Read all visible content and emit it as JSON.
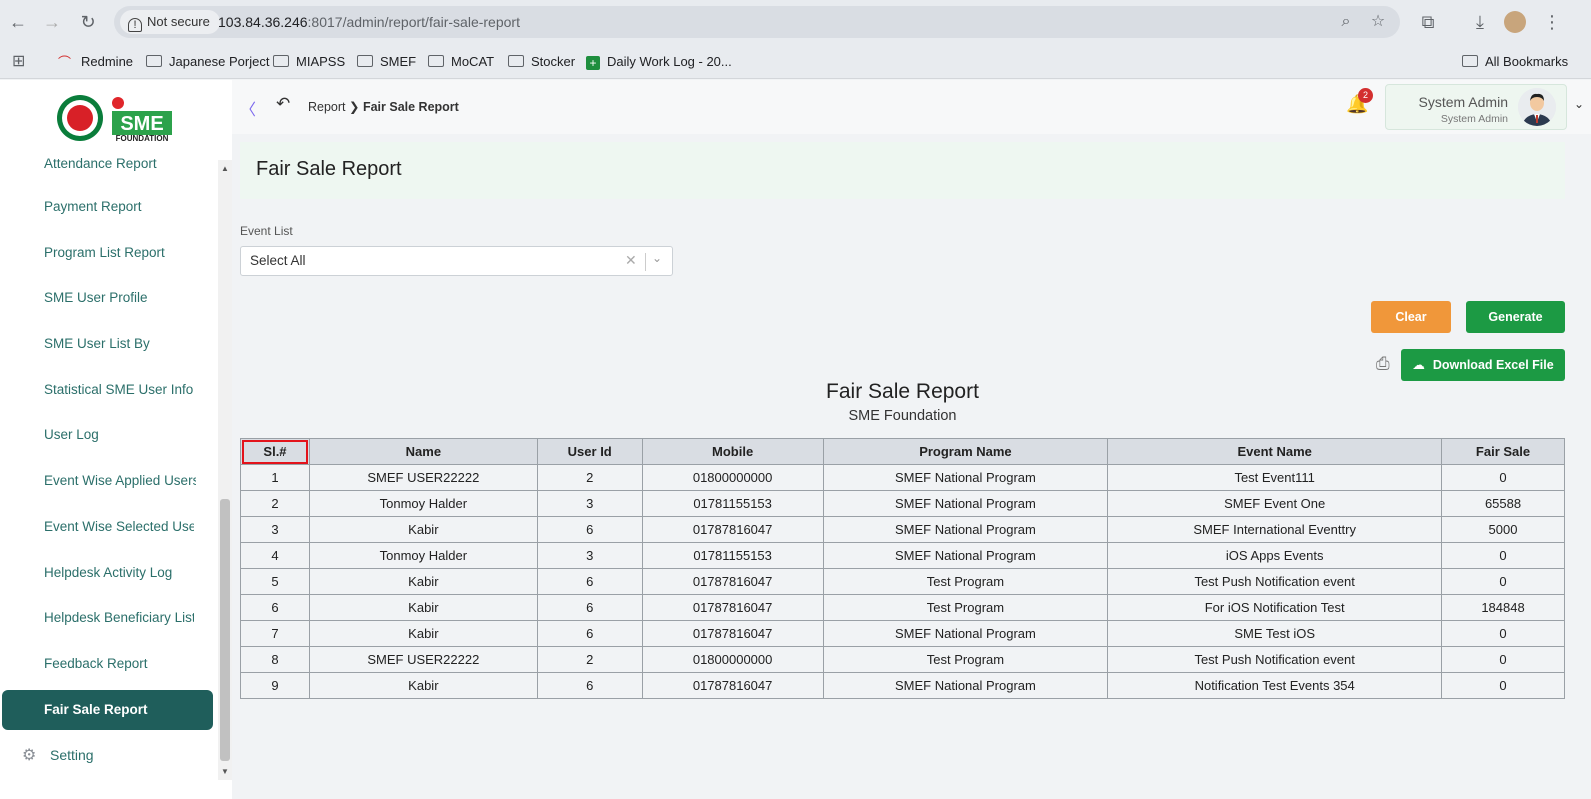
{
  "browser": {
    "security_label": "Not secure",
    "url_host": "103.84.36.246",
    "url_rest": ":8017/admin/report/fair-sale-report",
    "bookmarks": [
      "Redmine",
      "Japanese Porject",
      "MIAPSS",
      "SMEF",
      "MoCAT",
      "Stocker",
      "Daily Work Log - 20..."
    ],
    "all_bookmarks": "All Bookmarks"
  },
  "logo": {
    "text": "SME",
    "sub": "FOUNDATION"
  },
  "sidebar": {
    "items": [
      {
        "label": "Attendance Report"
      },
      {
        "label": "Payment Report"
      },
      {
        "label": "Program List Report"
      },
      {
        "label": "SME User Profile"
      },
      {
        "label": "SME User List By"
      },
      {
        "label": "Statistical SME User Info"
      },
      {
        "label": "User Log"
      },
      {
        "label": "Event Wise Applied Users"
      },
      {
        "label": "Event Wise Selected Users"
      },
      {
        "label": "Helpdesk Activity Log"
      },
      {
        "label": "Helpdesk Beneficiary List"
      },
      {
        "label": "Feedback Report"
      },
      {
        "label": "Fair Sale Report"
      }
    ],
    "setting_label": "Setting"
  },
  "topbar": {
    "breadcrumb_parent": "Report",
    "breadcrumb_current": "Fair Sale Report",
    "notification_count": "2",
    "user_name": "System Admin",
    "user_role": "System Admin"
  },
  "page": {
    "title": "Fair Sale Report",
    "event_list_label": "Event List",
    "event_list_value": "Select All",
    "clear_label": "Clear",
    "generate_label": "Generate",
    "download_label": "Download Excel File",
    "report_title": "Fair Sale Report",
    "report_subtitle": "SME Foundation"
  },
  "table": {
    "headers": [
      "Sl.#",
      "Name",
      "User Id",
      "Mobile",
      "Program Name",
      "Event Name",
      "Fair Sale"
    ],
    "rows": [
      [
        "1",
        "SMEF USER22222",
        "2",
        "01800000000",
        "SMEF National Program",
        "Test Event111",
        "0"
      ],
      [
        "2",
        "Tonmoy Halder",
        "3",
        "01781155153",
        "SMEF National Program",
        "SMEF Event One",
        "65588"
      ],
      [
        "3",
        "Kabir",
        "6",
        "01787816047",
        "SMEF National Program",
        "SMEF International Eventtry",
        "5000"
      ],
      [
        "4",
        "Tonmoy Halder",
        "3",
        "01781155153",
        "SMEF National Program",
        "iOS Apps Events",
        "0"
      ],
      [
        "5",
        "Kabir",
        "6",
        "01787816047",
        "Test Program",
        "Test Push Notification event",
        "0"
      ],
      [
        "6",
        "Kabir",
        "6",
        "01787816047",
        "Test Program",
        "For iOS Notification Test",
        "184848"
      ],
      [
        "7",
        "Kabir",
        "6",
        "01787816047",
        "SMEF National Program",
        "SME Test iOS",
        "0"
      ],
      [
        "8",
        "SMEF USER22222",
        "2",
        "01800000000",
        "Test Program",
        "Test Push Notification event",
        "0"
      ],
      [
        "9",
        "Kabir",
        "6",
        "01787816047",
        "SMEF National Program",
        "Notification Test Events 354",
        "0"
      ]
    ]
  },
  "colors": {
    "accent": "#1f5e5b",
    "generate": "#1c9a44",
    "clear": "#f0973a",
    "highlight": "#e3131b"
  }
}
